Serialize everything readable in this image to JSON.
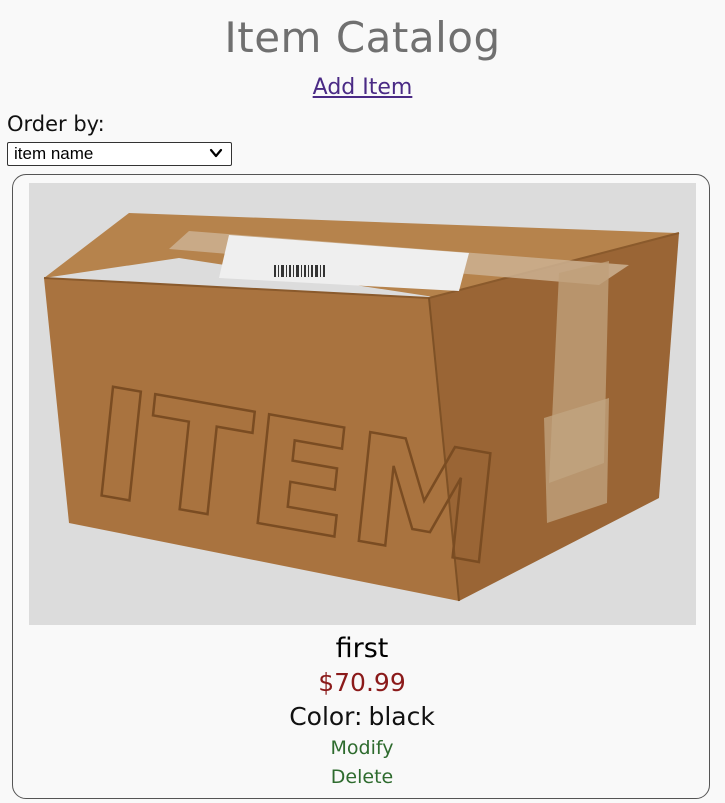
{
  "header": {
    "title": "Item Catalog",
    "add_item_label": "Add Item"
  },
  "sort": {
    "label": "Order by:",
    "selected": "item name"
  },
  "items": [
    {
      "image_text": "ITEM",
      "name": "first",
      "price": "$70.99",
      "color_label": "Color:",
      "color": "black",
      "modify_label": "Modify",
      "delete_label": "Delete"
    }
  ],
  "colors": {
    "background": "#f9f9f9",
    "title": "#707070",
    "link": "#4a2a85",
    "price": "#8b1a1a",
    "action": "#2e6b2e"
  },
  "icons": {
    "select_arrow": "chevron-down-icon"
  }
}
